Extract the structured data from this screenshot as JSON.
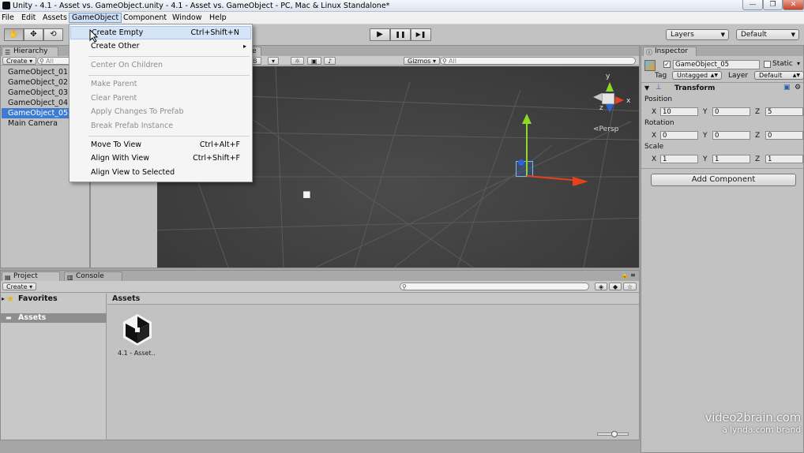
{
  "window": {
    "title": "Unity - 4.1 - Asset vs. GameObject.unity - 4.1 - Asset vs. GameObject - PC, Mac & Linux Standalone*",
    "minimize_glyph": "—",
    "maximize_glyph": "❐",
    "close_glyph": "✕"
  },
  "menubar": {
    "items": [
      "File",
      "Edit",
      "Assets",
      "GameObject",
      "Component",
      "Window",
      "Help"
    ]
  },
  "toolbar": {
    "tool_hand": "✋",
    "tool_move": "✥",
    "tool_rotate": "⟲",
    "play": "▶",
    "pause": "❚❚",
    "step": "▶❚",
    "layers_label": "Layers",
    "layout_label": "Default"
  },
  "gameobject_menu": {
    "items": [
      {
        "label": "Create Empty",
        "shortcut": "Ctrl+Shift+N",
        "state": "hover"
      },
      {
        "label": "Create Other",
        "submenu": "▸"
      },
      {
        "label": "Center On Children",
        "state": "disabled"
      },
      {
        "label": "Make Parent",
        "state": "disabled"
      },
      {
        "label": "Clear Parent",
        "state": "disabled"
      },
      {
        "label": "Apply Changes To Prefab",
        "state": "disabled"
      },
      {
        "label": "Break Prefab Instance",
        "state": "disabled"
      },
      {
        "label": "Move To View",
        "shortcut": "Ctrl+Alt+F"
      },
      {
        "label": "Align With View",
        "shortcut": "Ctrl+Shift+F"
      },
      {
        "label": "Align View to Selected"
      }
    ]
  },
  "hierarchy": {
    "tab_label": "Hierarchy",
    "create_label": "Create",
    "search_placeholder": "All",
    "items": [
      "GameObject_01",
      "GameObject_02",
      "GameObject_03",
      "GameObject_04",
      "GameObject_05",
      "Main Camera"
    ],
    "selected_index": 4
  },
  "scene": {
    "tab_fragment": "e",
    "shading_fragment": "B",
    "gizmos_label": "Gizmos",
    "search_placeholder": "All",
    "persp_label": "Persp",
    "axis_y": "y",
    "axis_x": "x",
    "axis_z": "z",
    "colors": {
      "axis_x": "#e8401c",
      "axis_y": "#8ed82a",
      "axis_z": "#2e63d8"
    }
  },
  "inspector": {
    "tab_label": "Inspector",
    "object_name": "GameObject_05",
    "static_label": "Static",
    "tag_label": "Tag",
    "tag_value": "Untagged",
    "layer_label": "Layer",
    "layer_value": "Default",
    "transform": {
      "title": "Transform",
      "position_label": "Position",
      "rotation_label": "Rotation",
      "scale_label": "Scale",
      "position": {
        "x": "10",
        "y": "0",
        "z": "5"
      },
      "rotation": {
        "x": "0",
        "y": "0",
        "z": "0"
      },
      "scale": {
        "x": "1",
        "y": "1",
        "z": "1"
      }
    },
    "add_component_label": "Add Component"
  },
  "project": {
    "tab_label": "Project",
    "console_tab_label": "Console",
    "create_label": "Create",
    "favorites_label": "Favorites",
    "assets_folder_label": "Assets",
    "assets_header": "Assets",
    "asset_items": [
      {
        "name": "4.1 - Asset..",
        "icon": "unity-logo-icon"
      }
    ]
  },
  "watermark": {
    "line1": "video2brain.com",
    "line2": "a lynda.com brand"
  }
}
